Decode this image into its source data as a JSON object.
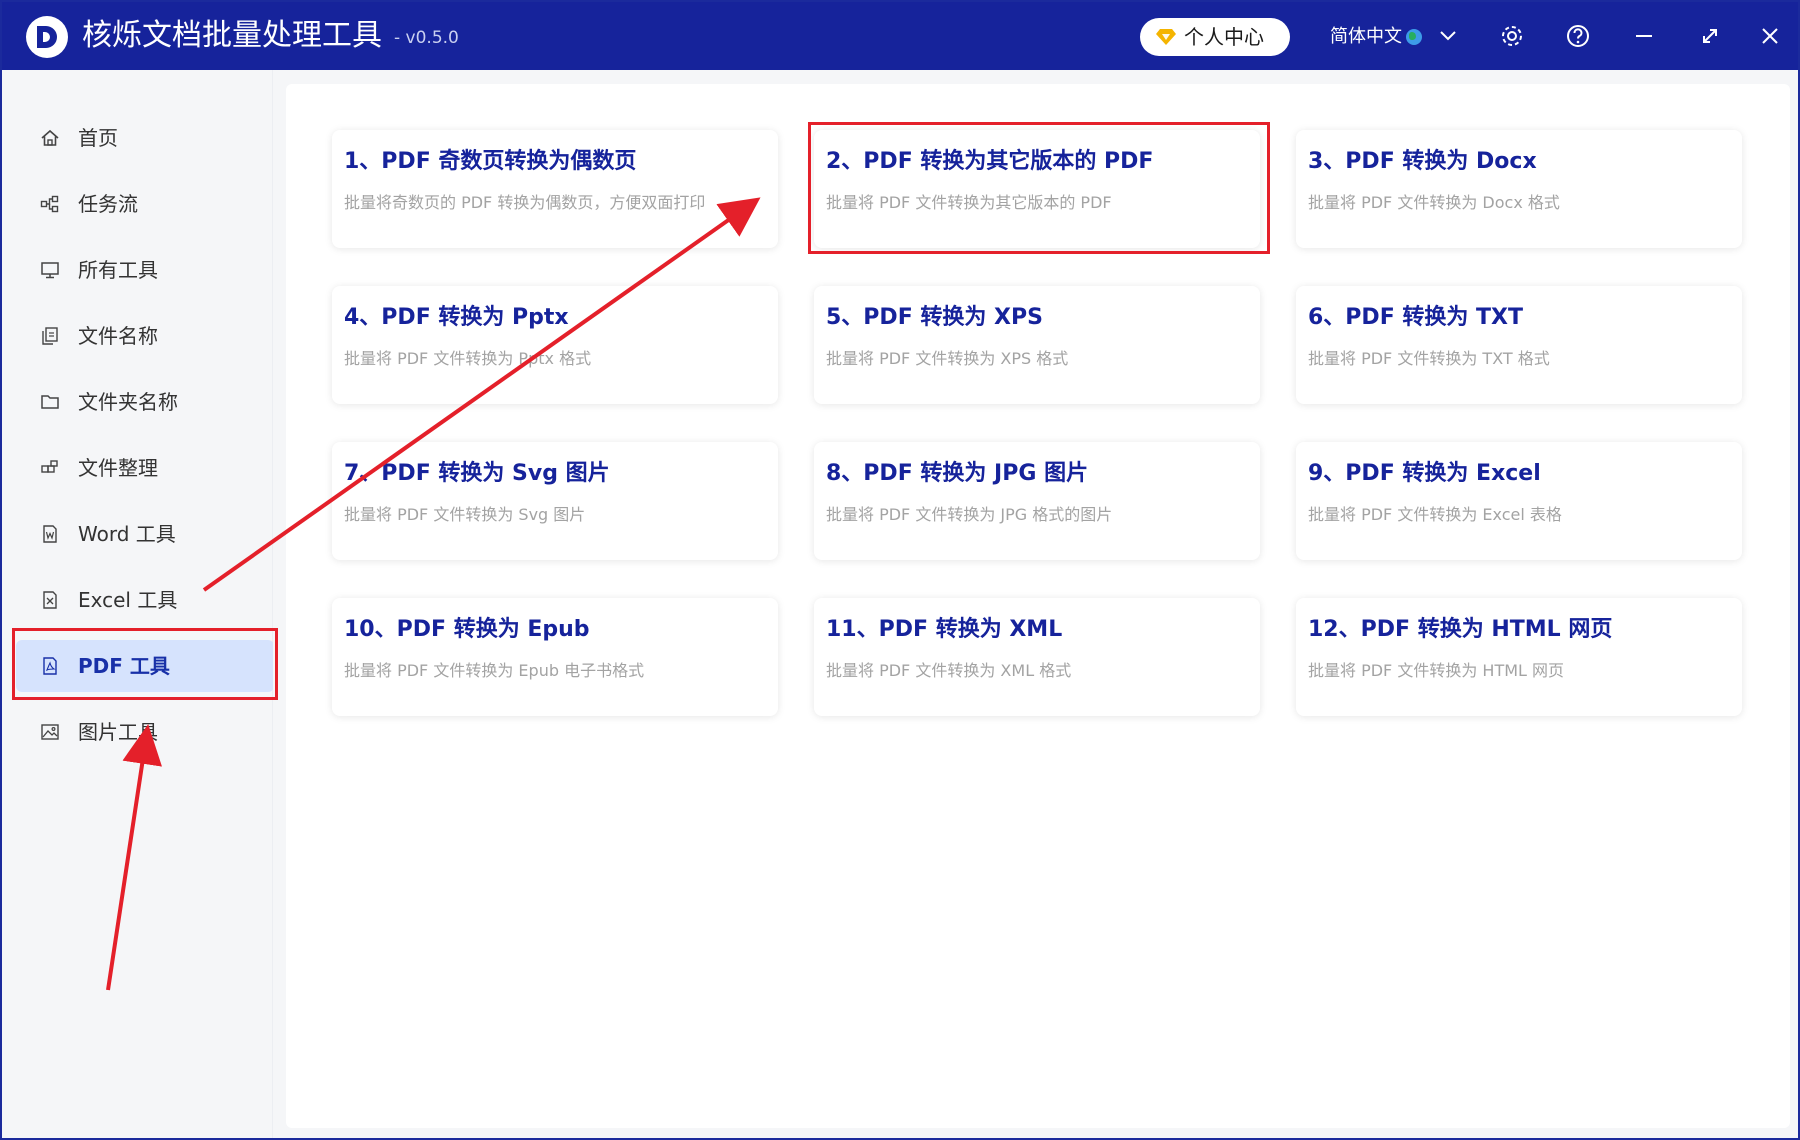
{
  "app": {
    "title": "核烁文档批量处理工具",
    "version": "- v0.5.0"
  },
  "titlebar": {
    "user_center": "个人中心",
    "language": "简体中文"
  },
  "sidebar": {
    "items": [
      {
        "label": "首页",
        "icon": "home-icon"
      },
      {
        "label": "任务流",
        "icon": "workflow-icon"
      },
      {
        "label": "所有工具",
        "icon": "monitor-icon"
      },
      {
        "label": "文件名称",
        "icon": "file-copy-icon"
      },
      {
        "label": "文件夹名称",
        "icon": "folder-icon"
      },
      {
        "label": "文件整理",
        "icon": "organize-icon"
      },
      {
        "label": "Word 工具",
        "icon": "word-file-icon"
      },
      {
        "label": "Excel 工具",
        "icon": "excel-file-icon"
      },
      {
        "label": "PDF 工具",
        "icon": "pdf-file-icon",
        "active": true
      },
      {
        "label": "图片工具",
        "icon": "image-icon"
      }
    ]
  },
  "tools": [
    {
      "title": "1、PDF 奇数页转换为偶数页",
      "desc": "批量将奇数页的 PDF 转换为偶数页，方便双面打印"
    },
    {
      "title": "2、PDF 转换为其它版本的 PDF",
      "desc": "批量将 PDF 文件转换为其它版本的 PDF"
    },
    {
      "title": "3、PDF 转换为 Docx",
      "desc": "批量将 PDF 文件转换为 Docx 格式"
    },
    {
      "title": "4、PDF 转换为 Pptx",
      "desc": "批量将 PDF 文件转换为 Pptx 格式"
    },
    {
      "title": "5、PDF 转换为 XPS",
      "desc": "批量将 PDF 文件转换为 XPS 格式"
    },
    {
      "title": "6、PDF 转换为 TXT",
      "desc": "批量将 PDF 文件转换为 TXT 格式"
    },
    {
      "title": "7、PDF 转换为 Svg 图片",
      "desc": "批量将 PDF 文件转换为 Svg 图片"
    },
    {
      "title": "8、PDF 转换为 JPG 图片",
      "desc": "批量将 PDF 文件转换为 JPG 格式的图片"
    },
    {
      "title": "9、PDF 转换为 Excel",
      "desc": "批量将 PDF 文件转换为 Excel 表格"
    },
    {
      "title": "10、PDF 转换为 Epub",
      "desc": "批量将 PDF 文件转换为 Epub 电子书格式"
    },
    {
      "title": "11、PDF 转换为 XML",
      "desc": "批量将 PDF 文件转换为 XML 格式"
    },
    {
      "title": "12、PDF 转换为 HTML 网页",
      "desc": "批量将 PDF 文件转换为 HTML 网页"
    }
  ],
  "colors": {
    "brand": "#16239b",
    "active_bg": "#d6e3fd",
    "annotation": "#e4202a"
  }
}
